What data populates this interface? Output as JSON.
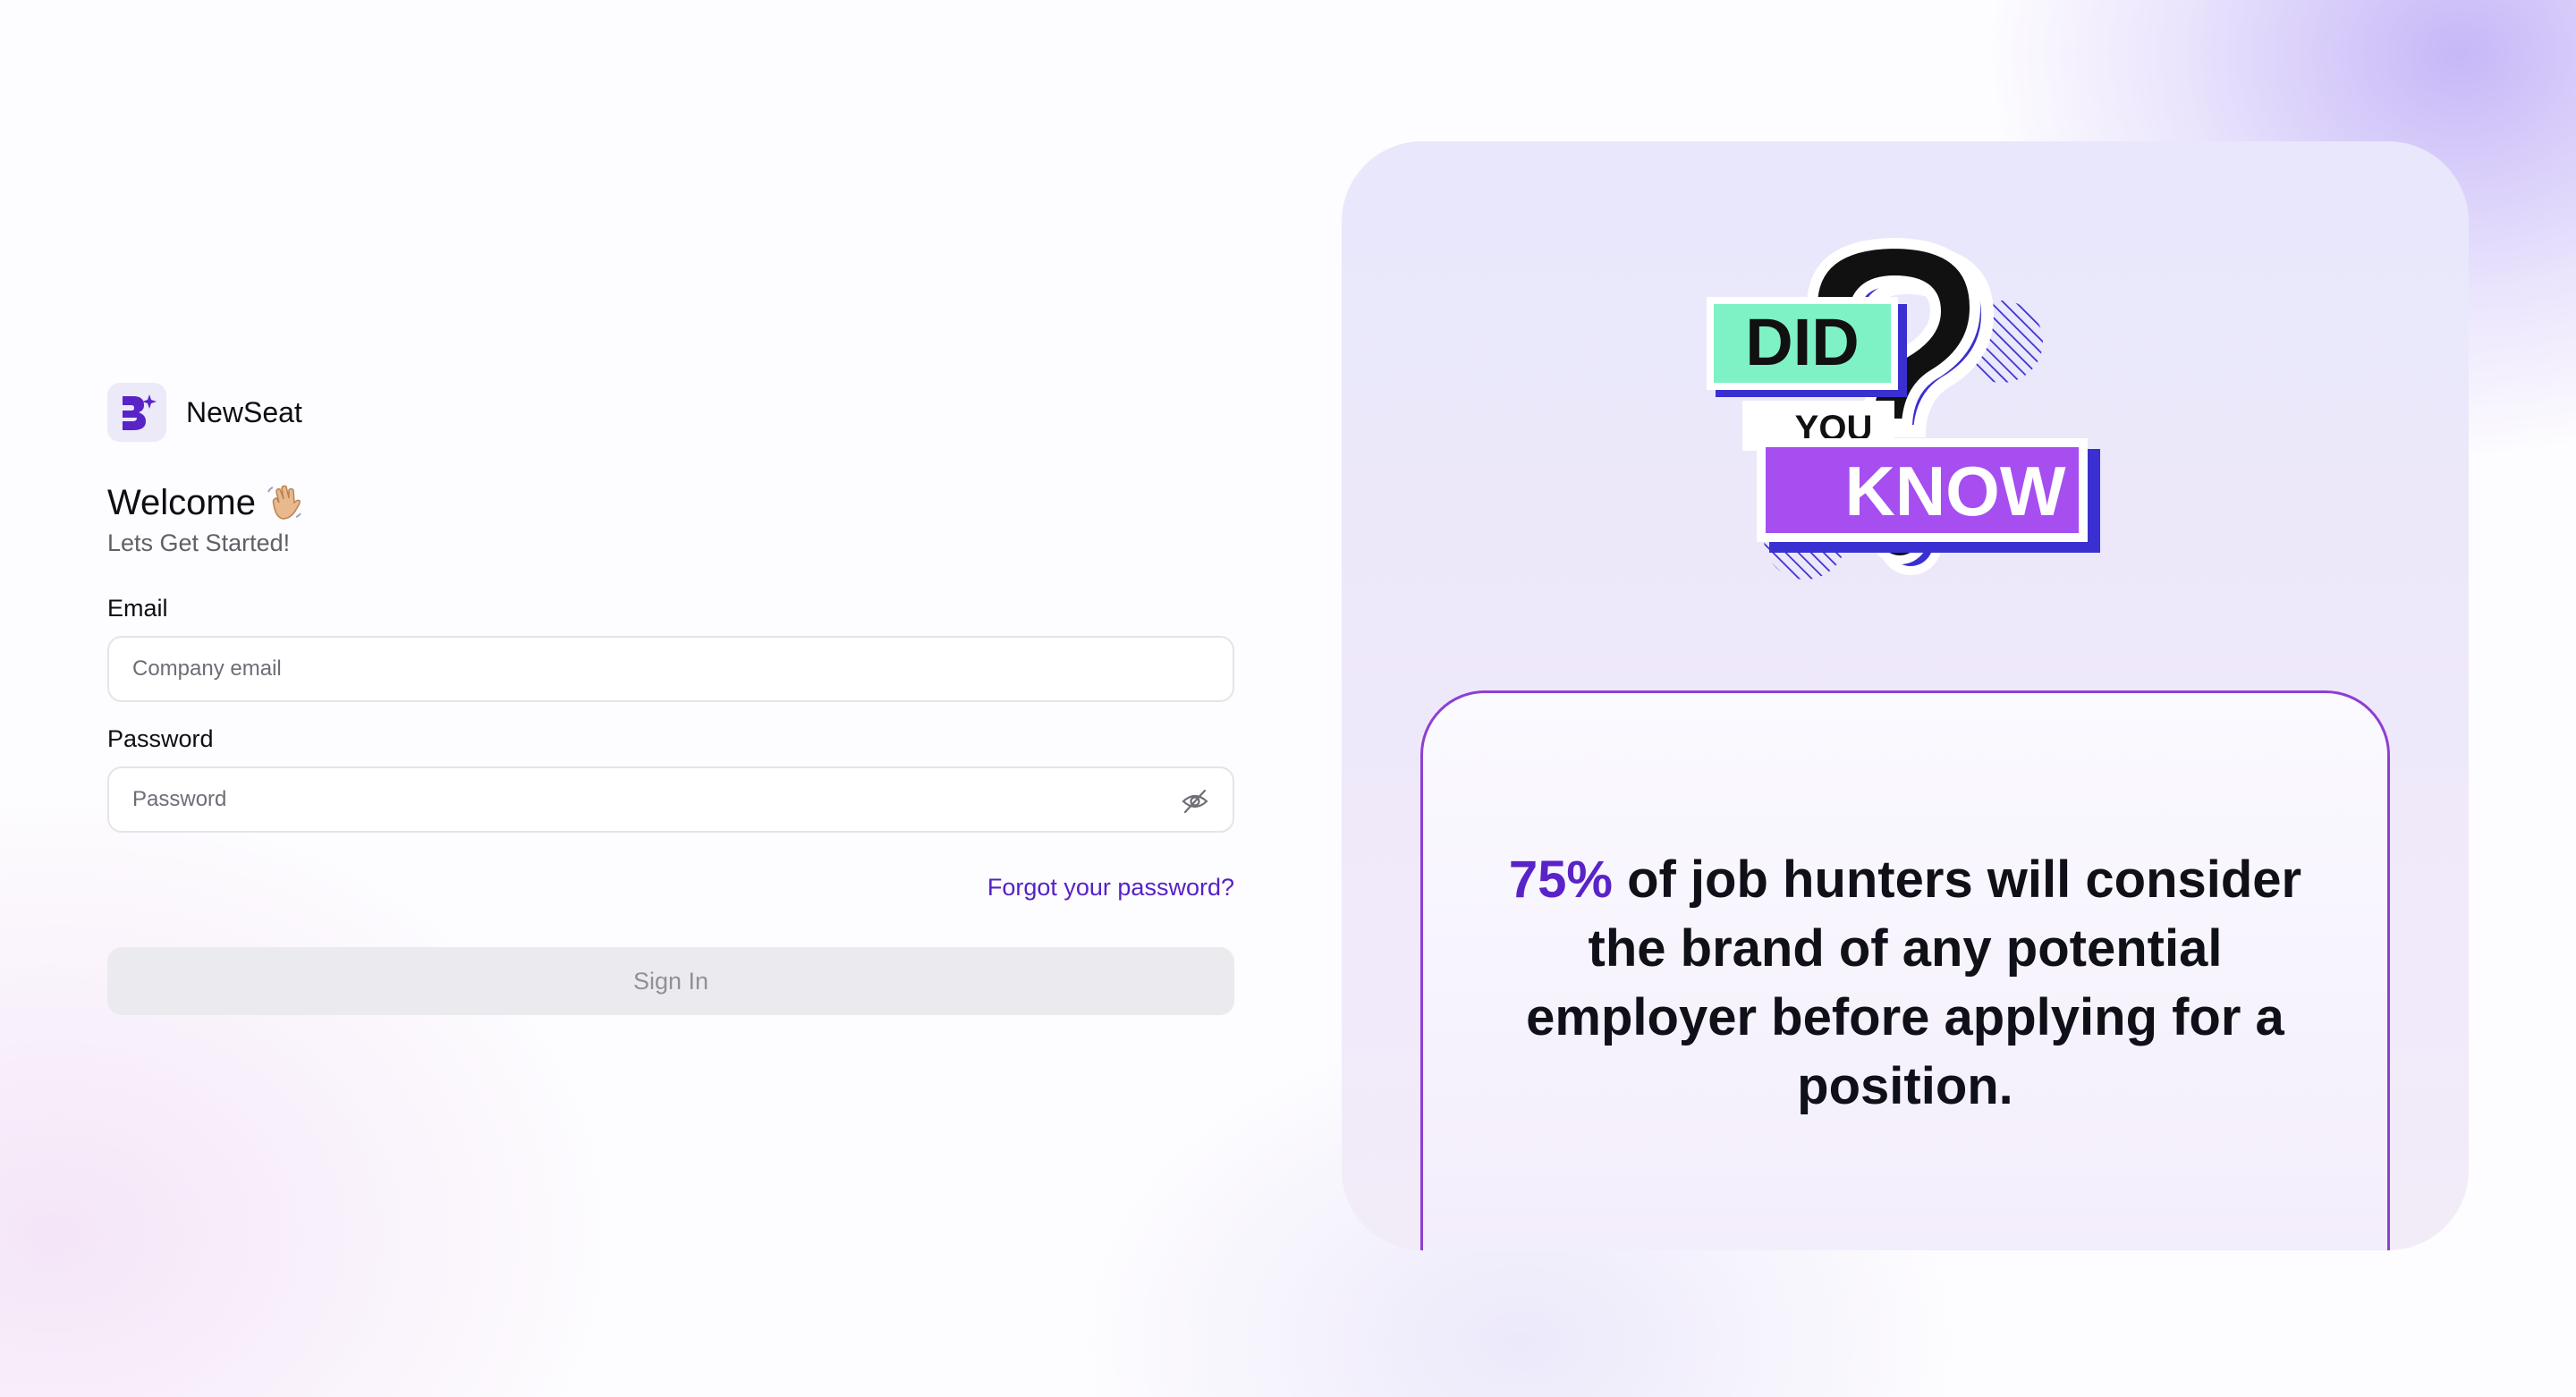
{
  "brand": {
    "name": "NewSeat",
    "logo_icon": "newseat-logo-icon"
  },
  "welcome": {
    "title": "Welcome",
    "emoji_icon": "waving-hand-icon",
    "subtitle": "Lets Get Started!"
  },
  "form": {
    "email": {
      "label": "Email",
      "placeholder": "Company email",
      "value": ""
    },
    "password": {
      "label": "Password",
      "placeholder": "Password",
      "value": "",
      "toggle_icon": "eye-off-icon"
    },
    "forgot_link": "Forgot your password?",
    "submit_label": "Sign In"
  },
  "promo": {
    "illustration": {
      "did": "DID",
      "you": "YOU",
      "know": "KNOW",
      "icon": "question-mark-icon"
    },
    "fact_highlight": "75%",
    "fact_text": " of job hunters will consider the brand of any potential employer before applying for a position."
  },
  "colors": {
    "accent": "#5521c7",
    "highlight": "#5a23c8",
    "card_border": "#8d3fd3",
    "did_bg": "#7ef2c4",
    "know_bg": "#a64ef0",
    "question_blue": "#3a2fd0",
    "button_disabled_bg": "#ebebef"
  }
}
